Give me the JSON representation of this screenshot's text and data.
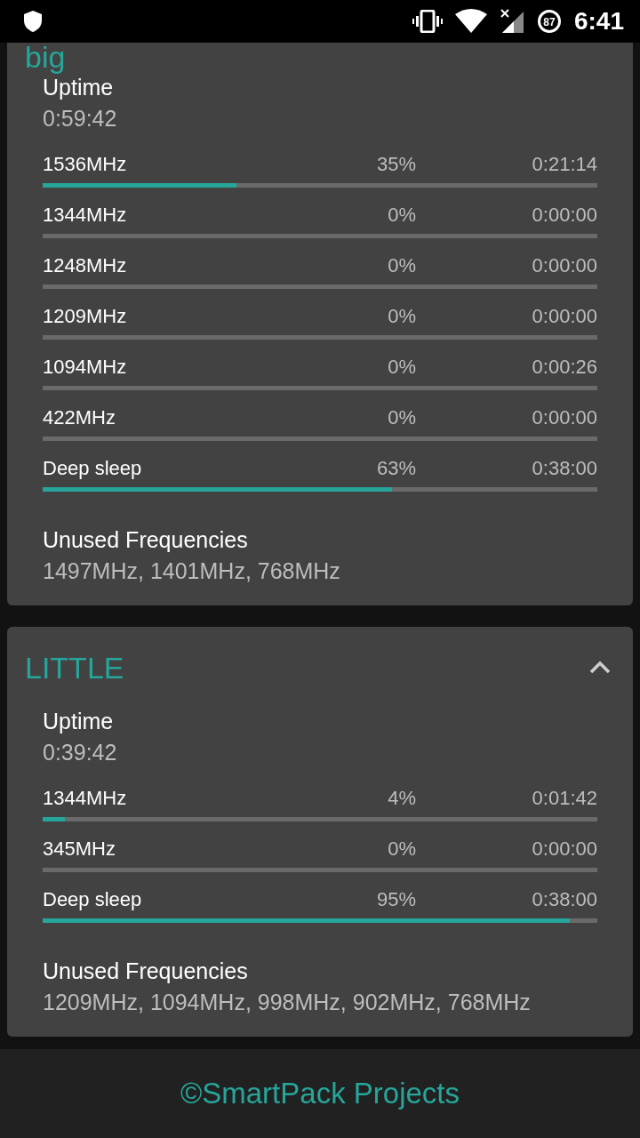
{
  "status_bar": {
    "battery": "87",
    "time": "6:41"
  },
  "clusters": [
    {
      "title": "big",
      "expanded": true,
      "uptime_label": "Uptime",
      "uptime": "0:59:42",
      "states": [
        {
          "freq": "1536MHz",
          "percent": "35%",
          "time": "0:21:14",
          "level": 0.35
        },
        {
          "freq": "1344MHz",
          "percent": "0%",
          "time": "0:00:00"
        },
        {
          "freq": "1248MHz",
          "percent": "0%",
          "time": "0:00:00"
        },
        {
          "freq": "1209MHz",
          "percent": "0%",
          "time": "0:00:00"
        },
        {
          "freq": "1094MHz",
          "percent": "0%",
          "time": "0:00:26"
        },
        {
          "freq": "422MHz",
          "percent": "0%",
          "time": "0:00:00"
        },
        {
          "freq": "Deep sleep",
          "percent": "63%",
          "time": "0:38:00",
          "level": 0.63
        }
      ],
      "unused_label": "Unused Frequencies",
      "unused": "1497MHz, 1401MHz, 768MHz"
    },
    {
      "title": "LITTLE",
      "expanded": true,
      "uptime_label": "Uptime",
      "uptime": "0:39:42",
      "states": [
        {
          "freq": "1344MHz",
          "percent": "4%",
          "time": "0:01:42",
          "level": 0.04
        },
        {
          "freq": "345MHz",
          "percent": "0%",
          "time": "0:00:00"
        },
        {
          "freq": "Deep sleep",
          "percent": "95%",
          "time": "0:38:00",
          "level": 0.95
        }
      ],
      "unused_label": "Unused Frequencies",
      "unused": "1209MHz, 1094MHz, 998MHz, 902MHz, 768MHz"
    }
  ],
  "footer": "©SmartPack Projects"
}
